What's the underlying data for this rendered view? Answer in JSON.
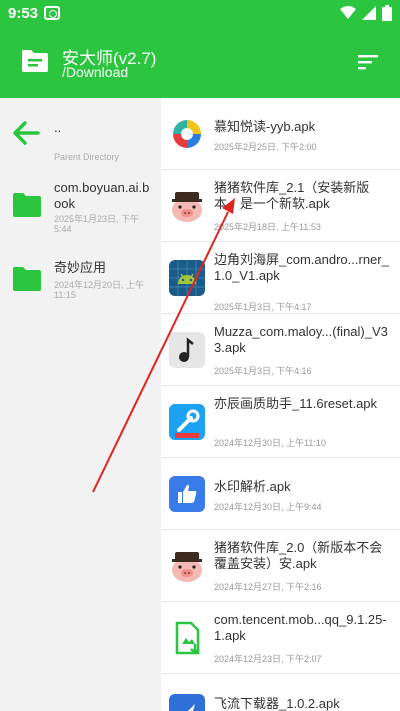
{
  "status_bar": {
    "time": "9:53"
  },
  "app_bar": {
    "title": "安大师(v2.7)",
    "path": "/Download"
  },
  "left_pane": {
    "items": [
      {
        "name": "..",
        "sub": "Parent Directory"
      },
      {
        "name": "com.boyuan.ai.book",
        "sub": "2025年1月23日, 下午5:44"
      },
      {
        "name": "奇妙应用",
        "sub": "2024年12月20日, 上午11:15"
      }
    ]
  },
  "files": [
    {
      "name": "慕知悦读-yyb.apk",
      "meta": "2025年2月25日, 下午2:00",
      "icon": "colorful-swirl-icon"
    },
    {
      "name": "猪猪软件库_2.1（安装新版本，是一个新软.apk",
      "meta": "2025年2月18日, 上午11:53",
      "icon": "pig-icon"
    },
    {
      "name": "边角刘海屏_com.andro...rner_1.0_V1.apk",
      "meta": "2025年1月3日, 下午4:17",
      "icon": "android-icon"
    },
    {
      "name": "Muzza_com.maloy...(final)_V33.apk",
      "meta": "2025年1月3日, 下午4:16",
      "icon": "music-note-icon"
    },
    {
      "name": "亦辰画质助手_11.6reset.apk",
      "meta": "2024年12月30日, 上午11:10",
      "icon": "wrench-icon"
    },
    {
      "name": "水印解析.apk",
      "meta": "2024年12月30日, 上午9:44",
      "icon": "thumbs-up-icon"
    },
    {
      "name": "猪猪软件库_2.0（新版本不会覆盖安装）安.apk",
      "meta": "2024年12月27日, 下午2:16",
      "icon": "pig-icon"
    },
    {
      "name": "com.tencent.mob...qq_9.1.25-1.apk",
      "meta": "2024年12月23日, 下午2:07",
      "icon": "apk-install-icon"
    },
    {
      "name": "飞流下载器_1.0.2.apk",
      "meta": "",
      "icon": "download-rocket-icon"
    }
  ],
  "colors": {
    "brand": "#2bc540",
    "left_bg": "#f2f2f2",
    "arrow": "#e0241f"
  }
}
